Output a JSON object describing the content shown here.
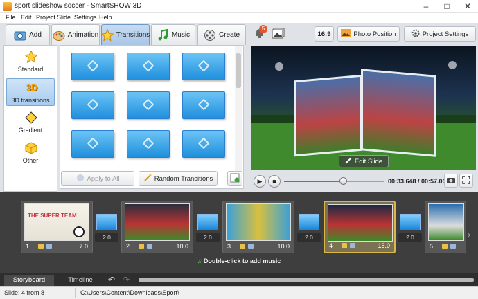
{
  "window": {
    "title": "sport slideshow soccer - SmartSHOW 3D",
    "controls": {
      "minimize": "–",
      "maximize": "□",
      "close": "✕"
    }
  },
  "menu": [
    "File",
    "Edit",
    "Project",
    "Slide",
    "Settings",
    "Help"
  ],
  "tabs": [
    {
      "label": "Add",
      "icon": "add-photo-icon",
      "active": false
    },
    {
      "label": "Animation",
      "icon": "palette-icon",
      "active": false
    },
    {
      "label": "Transitions",
      "icon": "star-icon",
      "active": true
    },
    {
      "label": "Music",
      "icon": "music-note-icon",
      "active": false
    },
    {
      "label": "Create",
      "icon": "film-reel-icon",
      "active": false
    }
  ],
  "transitions": {
    "categories": [
      {
        "label": "Standard",
        "icon": "star-icon",
        "active": false
      },
      {
        "label": "3D transitions",
        "icon": "3d-text-icon",
        "active": true
      },
      {
        "label": "Gradient",
        "icon": "gradient-icon",
        "active": false
      },
      {
        "label": "Other",
        "icon": "cube-icon",
        "active": false
      }
    ],
    "apply_all_label": "Apply to All",
    "random_label": "Random Transitions"
  },
  "top_right": {
    "notification_count": "5",
    "aspect_label": "16:9",
    "photo_position_label": "Photo Position",
    "project_settings_label": "Project Settings"
  },
  "preview": {
    "edit_slide_label": "Edit Slide",
    "time_label": "00:33.648 / 00:57.000",
    "progress": 0.59
  },
  "storyboard": {
    "slides": [
      {
        "num": "1",
        "duration": "7.0",
        "caption": "THE SUPER TEAM",
        "selected": false
      },
      {
        "num": "2",
        "duration": "10.0",
        "caption": "",
        "selected": false
      },
      {
        "num": "3",
        "duration": "10.0",
        "caption": "",
        "selected": false
      },
      {
        "num": "4",
        "duration": "15.0",
        "caption": "",
        "selected": true
      },
      {
        "num": "5",
        "duration": "",
        "caption": "",
        "selected": false
      }
    ],
    "transition_durations": [
      "2.0",
      "2.0",
      "2.0",
      "2.0"
    ],
    "music_hint": "Double-click to add music"
  },
  "bottom_tabs": [
    {
      "label": "Storyboard",
      "active": true
    },
    {
      "label": "Timeline",
      "active": false
    }
  ],
  "status": {
    "slide": "Slide: 4 from 8",
    "path": "C:\\Users\\Content\\Downloads\\Sport\\"
  }
}
